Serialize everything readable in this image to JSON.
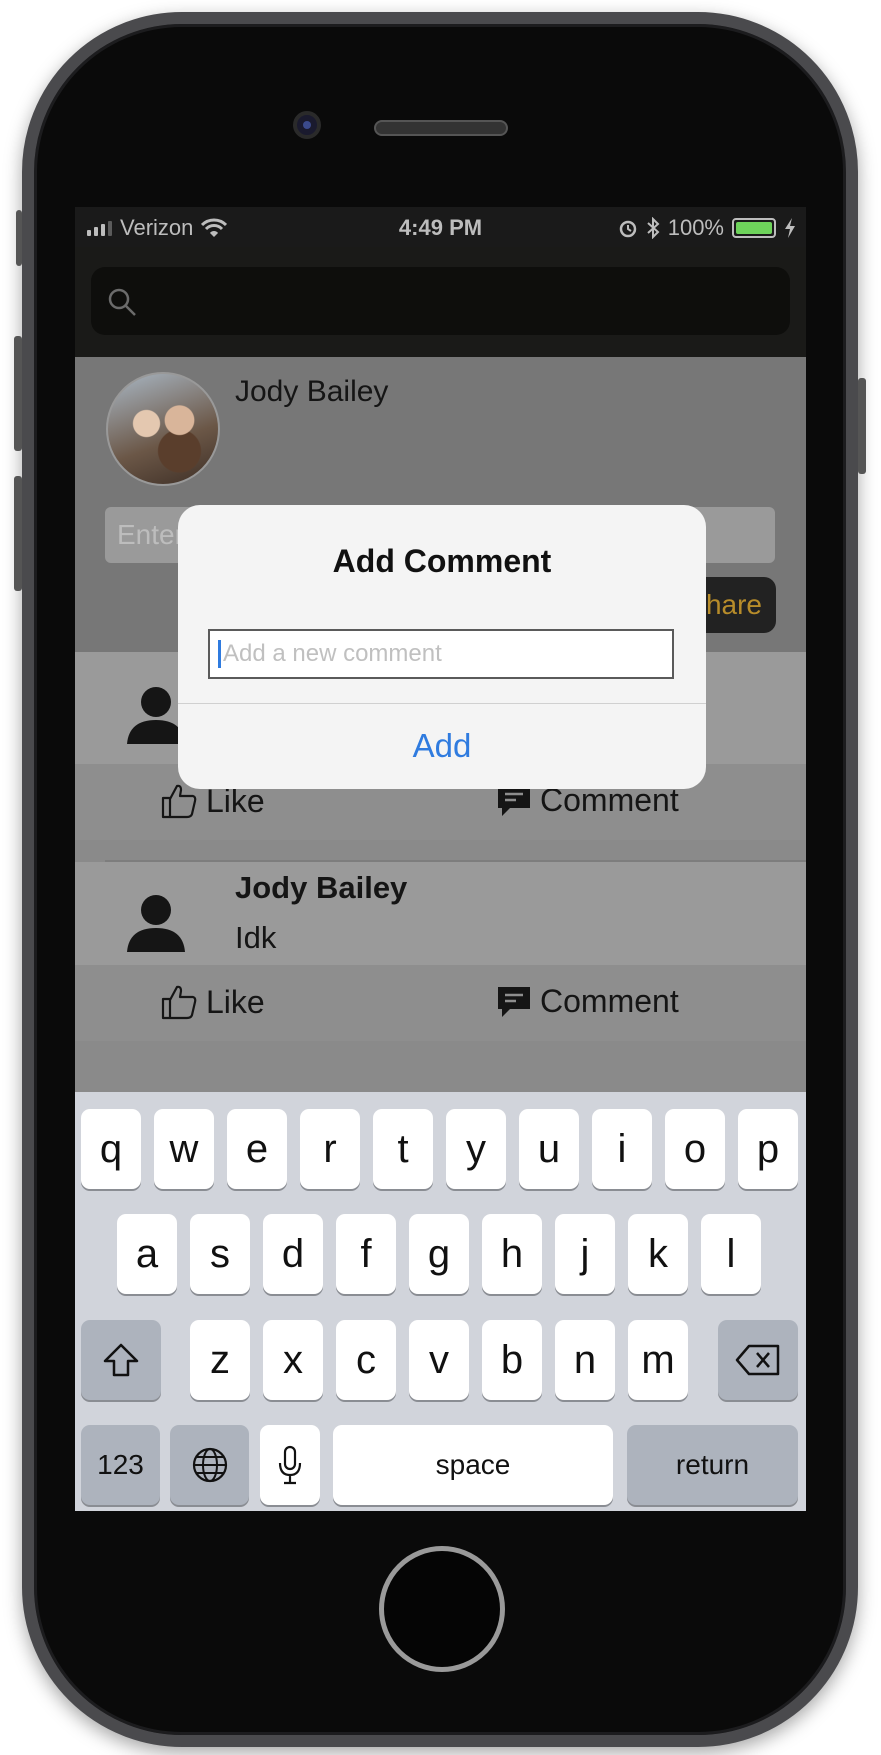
{
  "status_bar": {
    "carrier": "Verizon",
    "time": "4:49 PM",
    "battery": "100%"
  },
  "composer": {
    "user_name": "Jody Bailey",
    "input_placeholder": "Enter",
    "share_label": "hare"
  },
  "feed": [
    {
      "author": "",
      "text": "",
      "like_label": "Like",
      "comment_label": "Comment"
    },
    {
      "author": "Jody Bailey",
      "text": "Idk",
      "like_label": "Like",
      "comment_label": "Comment"
    }
  ],
  "alert": {
    "title": "Add Comment",
    "placeholder": "Add a new comment",
    "action_label": "Add"
  },
  "keyboard": {
    "row1": [
      "q",
      "w",
      "e",
      "r",
      "t",
      "y",
      "u",
      "i",
      "o",
      "p"
    ],
    "row2": [
      "a",
      "s",
      "d",
      "f",
      "g",
      "h",
      "j",
      "k",
      "l"
    ],
    "row3": [
      "z",
      "x",
      "c",
      "v",
      "b",
      "n",
      "m"
    ],
    "numbers_label": "123",
    "space_label": "space",
    "return_label": "return"
  },
  "colors": {
    "accent": "#2f7bdf",
    "share_text": "#b78c2a",
    "battery_fill": "#6ed35b",
    "keyboard_bg": "#d1d4db"
  },
  "icons": [
    "search-icon",
    "wifi-icon",
    "alarm-icon",
    "bluetooth-icon",
    "charging-icon",
    "thumbs-up-icon",
    "comment-bubble-icon",
    "person-icon",
    "shift-icon",
    "backspace-icon",
    "globe-icon",
    "microphone-icon"
  ]
}
